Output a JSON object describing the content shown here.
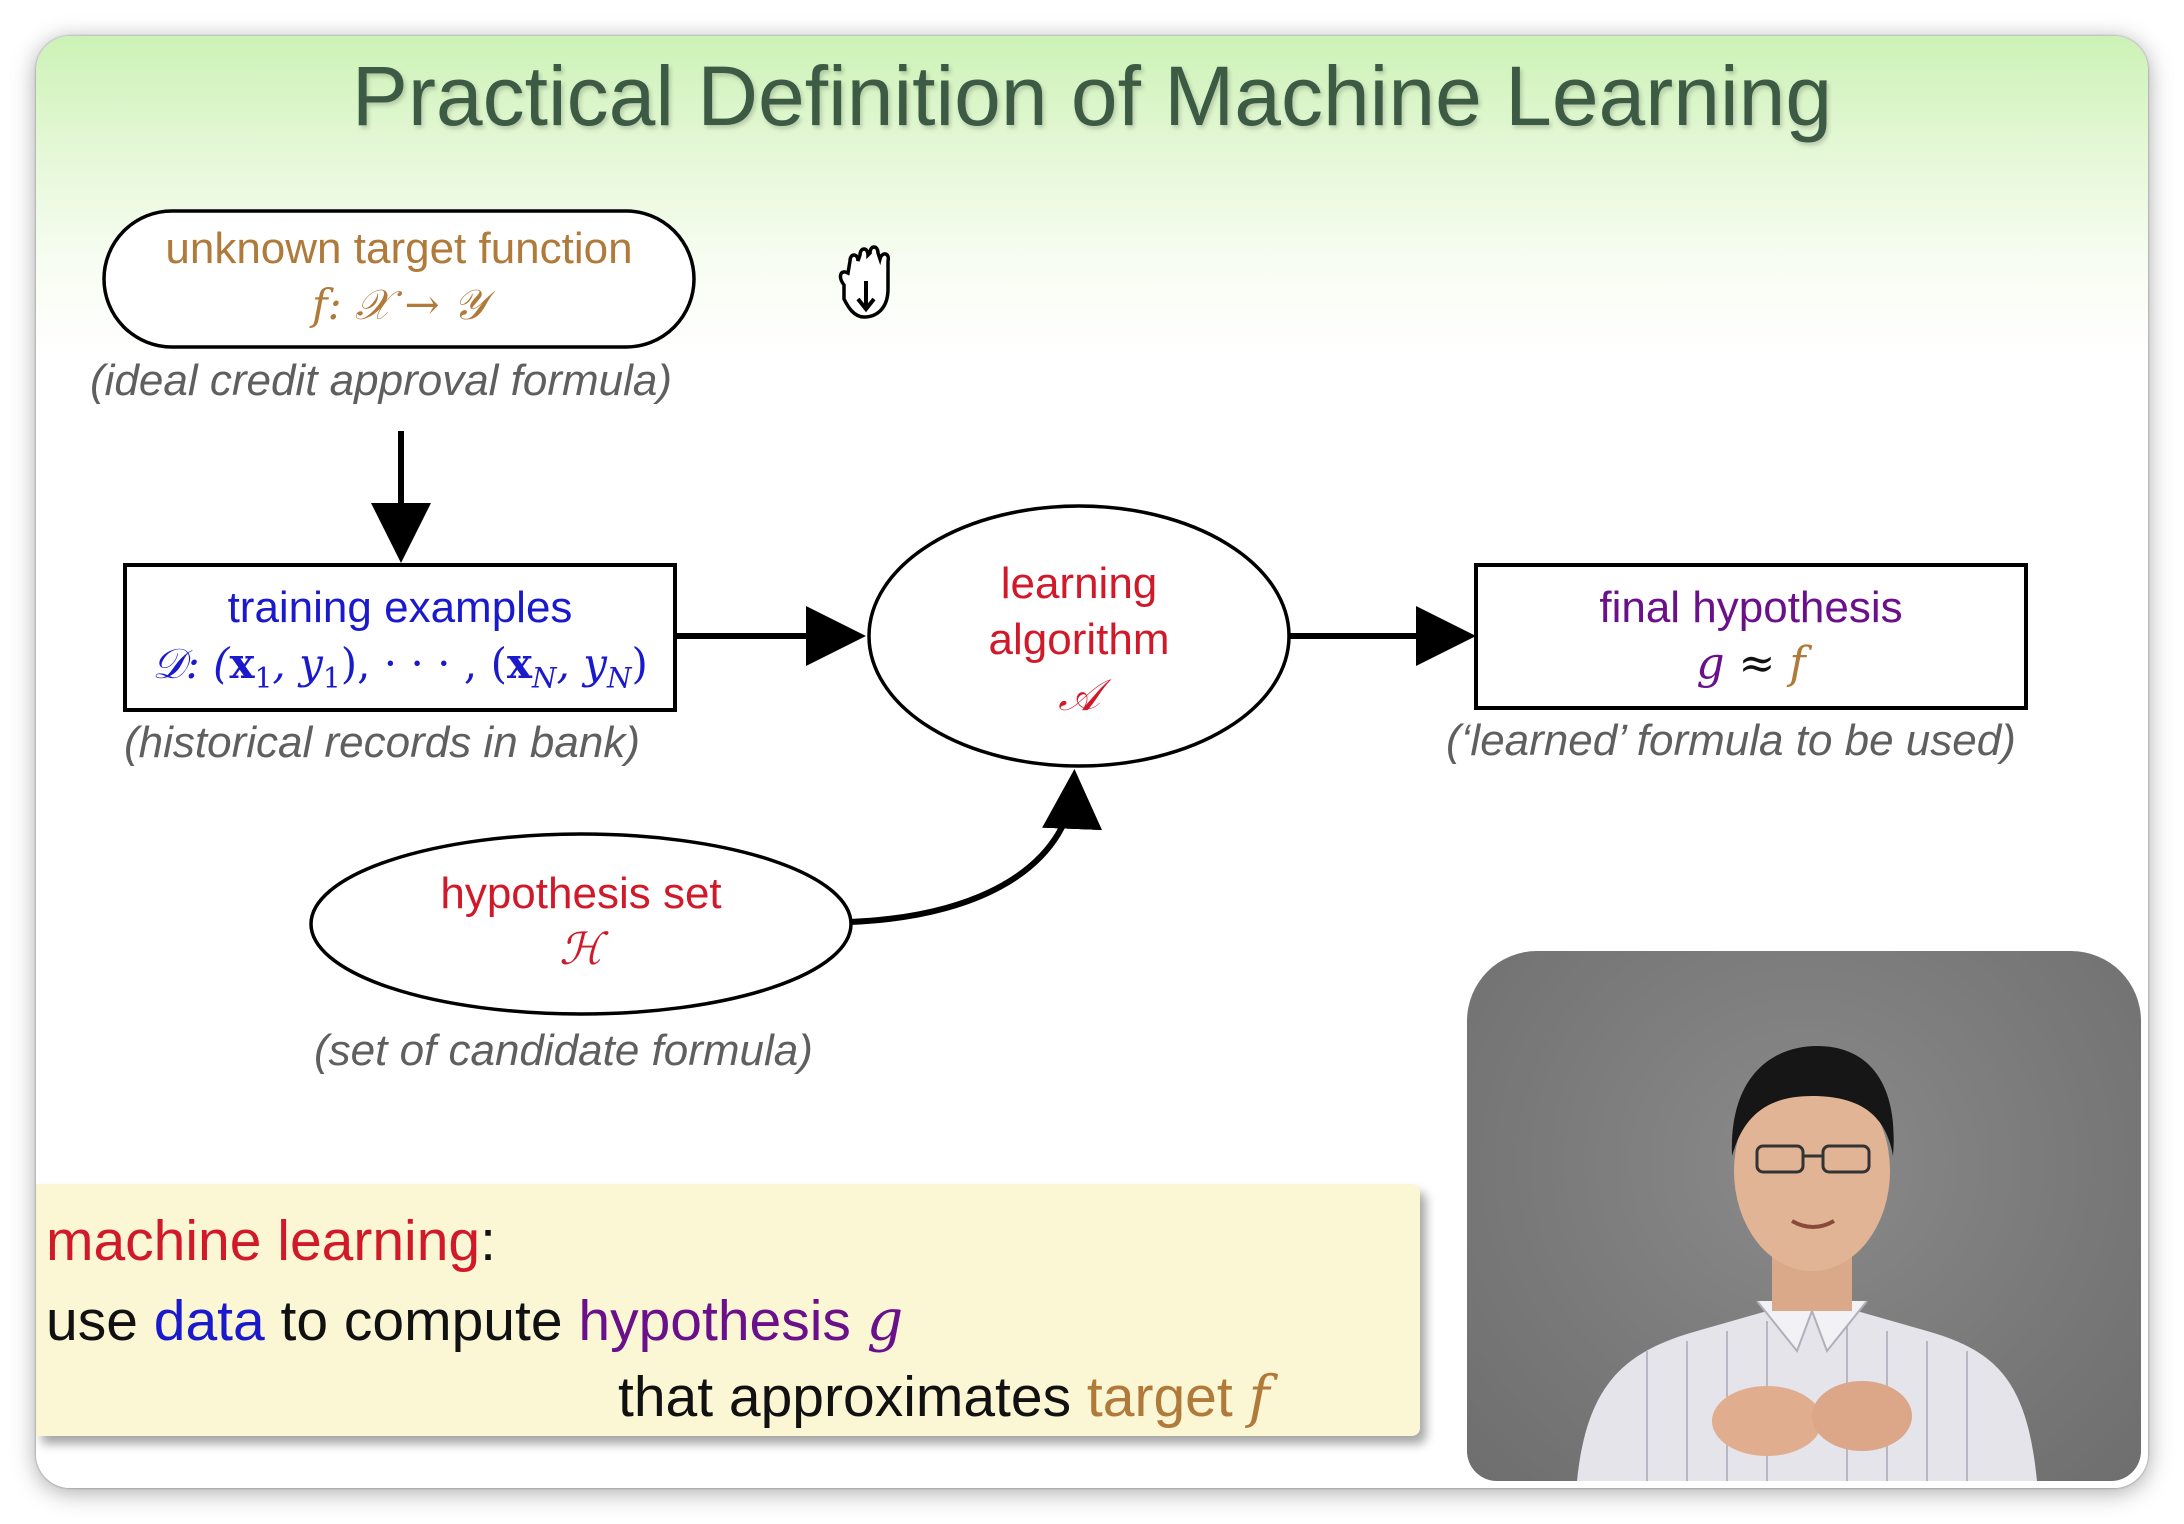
{
  "slide": {
    "title": "Practical Definition of Machine Learning"
  },
  "nodes": {
    "target": {
      "label": "unknown target function",
      "formula": "f: 𝒳 → 𝒴",
      "caption": "(ideal credit approval formula)"
    },
    "training": {
      "label": "training examples",
      "formula": "𝒟: (x₁, y₁), · · · , (x_N, y_N)",
      "formula_parts": [
        "𝒟: (",
        "x",
        "1",
        ", ",
        "y",
        "1",
        "), · · · , (",
        "x",
        "N",
        ", ",
        "y",
        "N",
        ")"
      ],
      "caption": "(historical records in bank)"
    },
    "algorithm": {
      "label_line1": "learning",
      "label_line2": "algorithm",
      "formula": "𝒜"
    },
    "final": {
      "label": "final hypothesis",
      "formula_g": "g",
      "formula_approx": " ≈ ",
      "formula_f": "f",
      "caption": "(‘learned’ formula to be used)"
    },
    "hypothesis_set": {
      "label": "hypothesis set",
      "formula": "ℋ",
      "caption": "(set of candidate formula)"
    }
  },
  "callout": {
    "line1_term": "machine learning",
    "line1_colon": ":",
    "line2_a": "use ",
    "line2_data": "data",
    "line2_b": " to compute ",
    "line2_hyp": "hypothesis ",
    "line2_g": "g",
    "line3_a": "that approximates ",
    "line3_target": "target ",
    "line3_f": "f"
  },
  "colors": {
    "title": "#3d5a44",
    "target_brown": "#b07a3a",
    "training_blue": "#1a1acc",
    "algorithm_red": "#d01a2a",
    "final_purple": "#6a108a",
    "caption_gray": "#5f5f5f",
    "callout_bg": "#fbf6d4"
  },
  "icons": {
    "cursor": "hand-grab-cursor-icon"
  },
  "video": {
    "description_icon": "presenter-video-feed"
  }
}
